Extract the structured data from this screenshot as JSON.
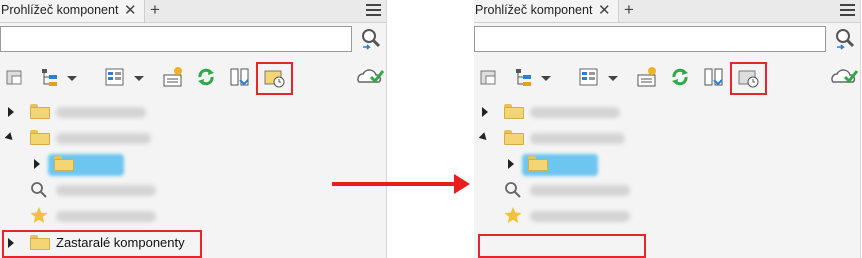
{
  "panel": {
    "tab_title": "Prohlížeč komponent",
    "close_glyph": "✕",
    "add_glyph": "+",
    "search_placeholder": ""
  },
  "icons": {
    "toolbar": [
      "import-icon",
      "tree-view-icon",
      "dropdown-icon",
      "list-view-icon",
      "dropdown-icon",
      "properties-icon",
      "refresh-icon",
      "folder-sync-icon",
      "obsolete-components-icon",
      "cloud-check-icon"
    ]
  },
  "tree_left": {
    "obsolete_label": "Zastaralé komponenty"
  },
  "colors": {
    "highlight": "#e8242c",
    "arrow": "#e81d1d",
    "folder": "#f3d574",
    "selection": "#6cc6f0"
  }
}
